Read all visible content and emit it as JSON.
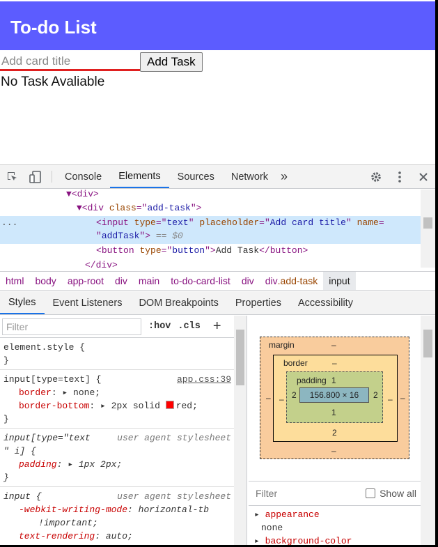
{
  "app": {
    "title": "To-do List",
    "input_placeholder": "Add card title",
    "add_button": "Add Task",
    "empty_message": "No Task Avaliable"
  },
  "devtools": {
    "tabs": [
      "Console",
      "Elements",
      "Sources",
      "Network"
    ],
    "more": "»",
    "elements": {
      "l1": "▼<div>",
      "l2_tag": "div",
      "l2_attr": "class",
      "l2_val": "add-task",
      "dots": "...",
      "sel_tag": "input",
      "sel_a1": "type",
      "sel_v1": "text",
      "sel_a2": "placeholder",
      "sel_v2": "Add card title",
      "sel_a3": "name",
      "sel_v3": "addTask",
      "sel_eq": "== $0",
      "btn_tag": "button",
      "btn_attr": "type",
      "btn_val": "button",
      "btn_text": "Add Task",
      "close_div": "</div>"
    },
    "breadcrumbs": [
      "html",
      "body",
      "app-root",
      "div",
      "main",
      "to-do-card-list",
      "div"
    ],
    "breadcrumb_addtask_tag": "div",
    "breadcrumb_addtask_cls": ".add-task",
    "breadcrumb_active": "input",
    "subtabs": [
      "Styles",
      "Event Listeners",
      "DOM Breakpoints",
      "Properties",
      "Accessibility"
    ],
    "styles": {
      "filter_placeholder": "Filter",
      "hov": ":hov",
      "cls": ".cls",
      "plus": "+",
      "r1_selector": "element.style {",
      "close": "}",
      "r2_selector": "input[type=text] {",
      "r2_source": "app.css:39",
      "r2_p1": "border",
      "r2_v1": "none;",
      "r2_p2": "border-bottom",
      "r2_v2a": "2px solid",
      "r2_v2b": "red;",
      "r3_selector_a": "input[type=\"text",
      "r3_selector_b": "\" i] {",
      "r3_source": "user agent stylesheet",
      "r3_p1": "padding",
      "r3_v1": "1px 2px;",
      "r4_selector": "input {",
      "r4_source": "user agent stylesheet",
      "r4_p1": "-webkit-writing-mode",
      "r4_v1": "horizontal-tb",
      "r4_v1b": "!important;",
      "r4_p2": "text-rendering",
      "r4_v2": "auto;"
    },
    "boxmodel": {
      "margin_label": "margin",
      "border_label": "border",
      "padding_label": "padding",
      "padding_top": "1",
      "padding_bottom": "1",
      "padding_left": "2",
      "padding_right": "2",
      "border_bottom": "2",
      "dash": "–",
      "content": "156.800 × 16"
    },
    "computed": {
      "filter_placeholder": "Filter",
      "show_all": "Show all",
      "prop1": "appearance",
      "val1": "none",
      "prop2": "background-color"
    }
  }
}
